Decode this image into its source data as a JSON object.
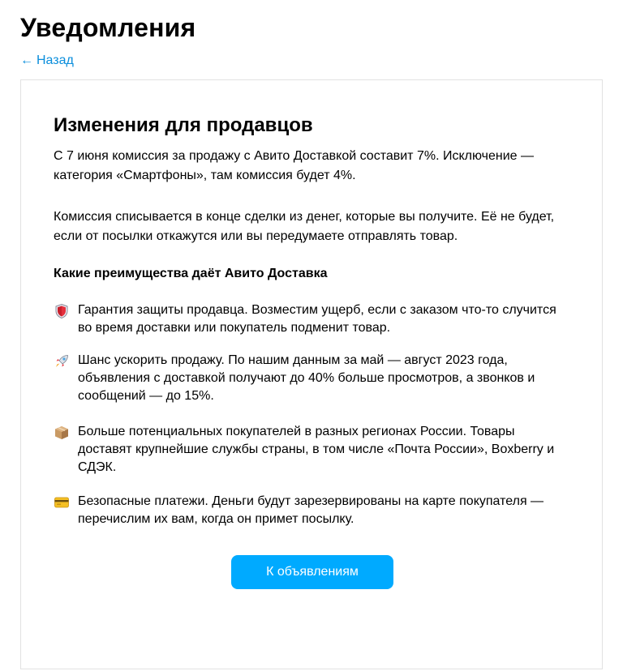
{
  "header": {
    "title": "Уведомления",
    "back_arrow": "←",
    "back_label": "Назад"
  },
  "card": {
    "title": "Изменения для продавцов",
    "paragraph1": "С 7 июня комиссия за продажу с Авито Доставкой составит 7%. Исключение — категория «Смартфоны», там комиссия будет 4%.",
    "paragraph2": "Комиссия списывается в конце сделки из денег, которые вы получите. Её не будет, если от посылки откажутся или вы передумаете отправлять товар.",
    "subheading": "Какие преимущества даёт Авито Доставка",
    "benefits": [
      {
        "icon": "shield-icon",
        "text": "Гарантия защиты продавца. Возместим ущерб, если с заказом что-то случится во время доставки или покупатель подменит товар."
      },
      {
        "icon": "rocket-icon",
        "text": "Шанс ускорить продажу. По нашим данным за май — август 2023 года, объявления с доставкой получают до 40% больше просмотров, а звонков и сообщений — до 15%."
      },
      {
        "icon": "package-icon",
        "text": "Больше потенциальных покупателей в разных регионах России. Товары доставят крупнейшие службы страны, в том числе «Почта России», Boxberry и СДЭК."
      },
      {
        "icon": "credit-card-icon",
        "text": "Безопасные платежи. Деньги будут зарезервированы на карте покупателя — перечислим их вам, когда он примет посылку."
      }
    ],
    "button_label": "К объявлениям"
  },
  "colors": {
    "accent": "#00aaff",
    "link": "#0a8edc",
    "card_border": "#e2e2e2"
  }
}
